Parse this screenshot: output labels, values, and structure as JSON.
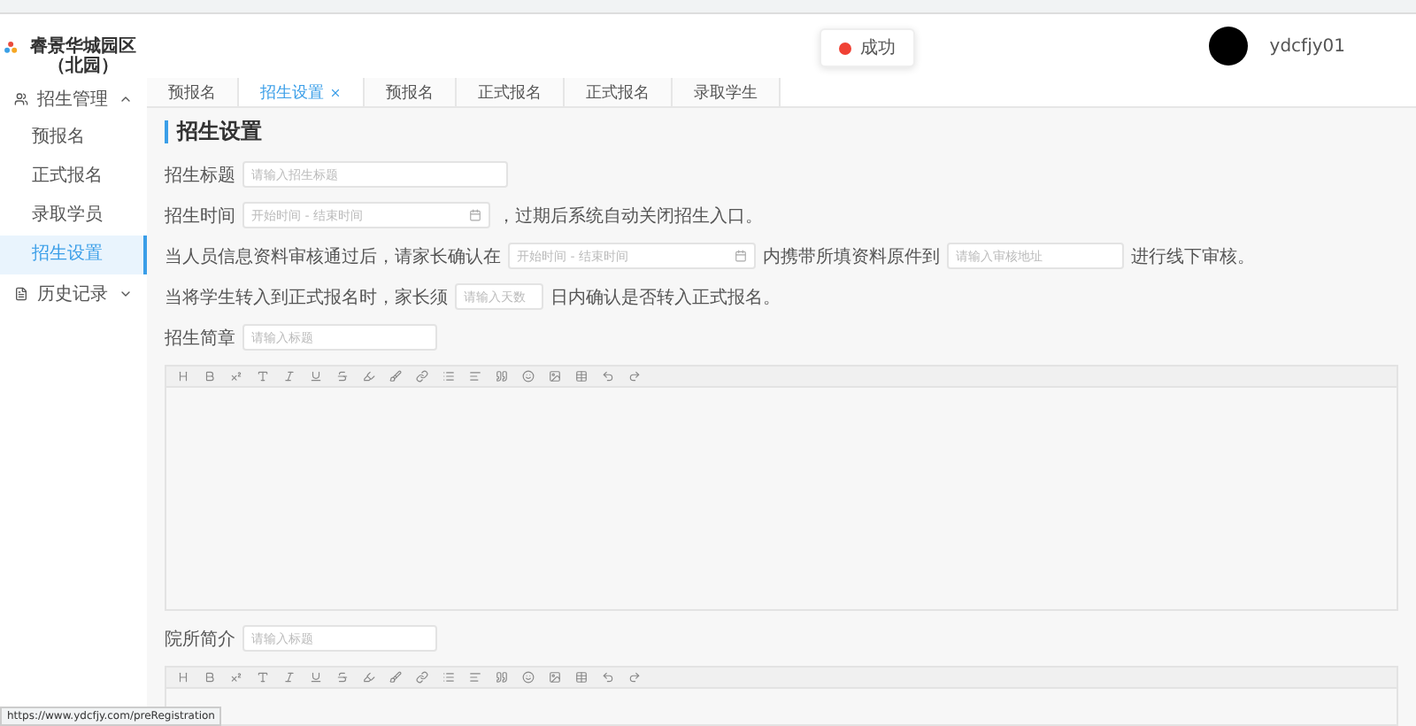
{
  "header": {
    "logo_title": "睿景华城园区（北园）",
    "toast": {
      "text": "成功"
    },
    "user": {
      "name": "ydcfjy01"
    }
  },
  "sidebar": [
    {
      "label": "招生管理",
      "expanded": true,
      "children": [
        {
          "label": "预报名",
          "selected": false
        },
        {
          "label": "正式报名",
          "selected": false
        },
        {
          "label": "录取学员",
          "selected": false
        },
        {
          "label": "招生设置",
          "selected": true
        }
      ]
    },
    {
      "label": "历史记录",
      "expanded": false
    }
  ],
  "tabs": [
    {
      "label": "预报名",
      "selected": false,
      "closable": false
    },
    {
      "label": "招生设置",
      "selected": true,
      "closable": true
    },
    {
      "label": "预报名",
      "selected": false,
      "closable": false
    },
    {
      "label": "正式报名",
      "selected": false,
      "closable": false
    },
    {
      "label": "正式报名",
      "selected": false,
      "closable": false
    },
    {
      "label": "录取学生",
      "selected": false,
      "closable": false
    }
  ],
  "page_title": "招生设置",
  "form_rows": [
    [
      {
        "kind": "text",
        "text": "招生标题"
      },
      {
        "kind": "input",
        "placeholder": "请输入招生标题"
      }
    ],
    [
      {
        "kind": "text",
        "text": "招生时间"
      },
      {
        "kind": "date",
        "placeholder": "开始时间 - 结束时间"
      },
      {
        "kind": "text",
        "text": "，过期后系统自动关闭招生入口。"
      }
    ],
    [
      {
        "kind": "text",
        "text": "当人员信息资料审核通过后，请家长确认在"
      },
      {
        "kind": "date",
        "placeholder": "开始时间 - 结束时间"
      },
      {
        "kind": "text",
        "text": "内携带所填资料原件到"
      },
      {
        "kind": "input",
        "placeholder": "请输入审核地址"
      },
      {
        "kind": "text",
        "text": "进行线下审核。"
      }
    ],
    [
      {
        "kind": "text",
        "text": "当将学生转入到正式报名时，家长须"
      },
      {
        "kind": "number",
        "placeholder": "请输入天数"
      },
      {
        "kind": "text",
        "text": "日内确认是否转入正式报名。"
      }
    ]
  ],
  "editors": [
    {
      "label": "招生简章",
      "placeholder": "请输入标题"
    },
    {
      "label": "院所简介",
      "placeholder": "请输入标题"
    }
  ],
  "status_url": "https://www.ydcfjy.com/preRegistration"
}
